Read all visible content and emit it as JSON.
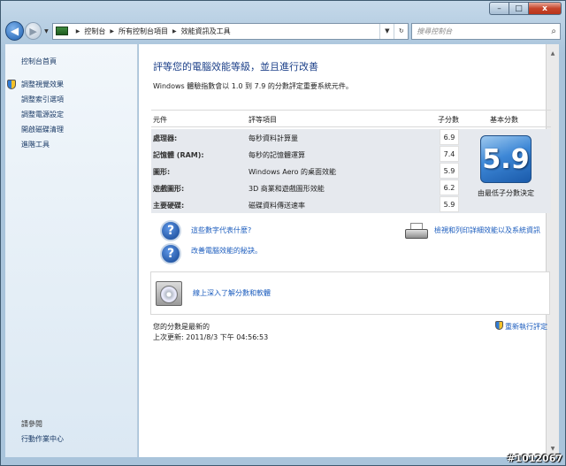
{
  "window": {
    "min_label": "–",
    "max_label": "□",
    "close_label": "x"
  },
  "nav": {
    "back_glyph": "◀",
    "fwd_glyph": "▶",
    "drop_glyph": "▼",
    "breadcrumbs": [
      "控制台",
      "所有控制台項目",
      "效能資訊及工具"
    ],
    "sep_glyph": "▶",
    "refresh_glyph": "↻",
    "addr_drop_glyph": "▼",
    "search_placeholder": "搜尋控制台",
    "search_glyph": "⌕"
  },
  "sidebar": {
    "items": [
      {
        "label": "控制台首頁"
      },
      {
        "label": "調整視覺效果"
      },
      {
        "label": "調整索引選項"
      },
      {
        "label": "調整電源設定"
      },
      {
        "label": "開啟磁碟清理"
      },
      {
        "label": "進階工具"
      }
    ],
    "see_also": "請參閱",
    "action_center": "行動作業中心"
  },
  "main": {
    "title": "評等您的電腦效能等級，並且進行改善",
    "subtitle": "Windows 體驗指數會以 1.0 到 7.9 的分數評定重要系統元件。",
    "headers": {
      "component": "元件",
      "rated": "評等項目",
      "subscore": "子分數",
      "base": "基本分數"
    },
    "rows": [
      {
        "component": "處理器:",
        "rated": "每秒資料計算量",
        "score": "6.9"
      },
      {
        "component": "記憶體 (RAM):",
        "rated": "每秒的記憶體運算",
        "score": "7.4"
      },
      {
        "component": "圖形:",
        "rated": "Windows Aero 的桌面效能",
        "score": "5.9"
      },
      {
        "component": "遊戲圖形:",
        "rated": "3D 商業和遊戲圖形效能",
        "score": "6.2"
      },
      {
        "component": "主要硬碟:",
        "rated": "磁碟資料傳送速率",
        "score": "5.9"
      }
    ],
    "base_score": "5.9",
    "base_caption": "由最低子分數決定",
    "link_meaning": "這些數字代表什麼?",
    "link_improve": "改善電腦效能的秘訣。",
    "link_print": "檢視和列印詳細效能以及系統資訊",
    "link_learn": "線上深入了解分數和軟體",
    "status_current": "您的分數是最新的",
    "status_updated": "上次更新: 2011/8/3 下午 04:56:53",
    "rerun": "重新執行評定"
  },
  "watermark": "#1012067",
  "colors": {
    "link": "#1c5dbe",
    "title": "#1b3f88"
  }
}
